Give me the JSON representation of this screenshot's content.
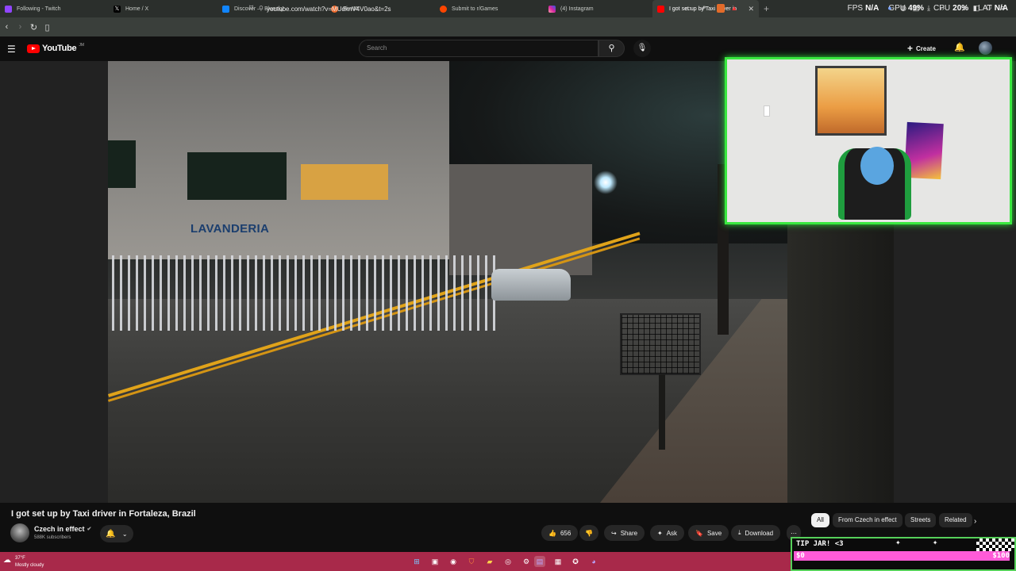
{
  "browser": {
    "tabs": [
      {
        "label": "Following - Twitch",
        "color": "#9146ff"
      },
      {
        "label": "Home / X",
        "color": "#000000"
      },
      {
        "label": "Discover — Bluesky",
        "color": "#1185fe"
      },
      {
        "label": "FiveM",
        "color": "#f06a2b"
      },
      {
        "label": "Submit to r/Games",
        "color": "#ff4500"
      },
      {
        "label": "(4) Instagram",
        "color": "#d6249f"
      },
      {
        "label": "I got set up by Taxi driver in",
        "color": "#ff0000",
        "active": true
      }
    ],
    "url": "youtube.com/watch?v=MUdknV4V0ao&t=2s"
  },
  "stats": {
    "fps_label": "FPS",
    "fps_value": "N/A",
    "gpu_label": "GPU",
    "gpu_value": "49%",
    "cpu_label": "CPU",
    "cpu_value": "20%",
    "lat_label": "LAT",
    "lat_value": "N/A"
  },
  "youtube": {
    "logo_text": "YouTube",
    "region": "JM",
    "search_placeholder": "Search",
    "create_label": "Create"
  },
  "video": {
    "sign_text": "LAVANDERIA",
    "title": "I got set up by Taxi driver in Fortaleza, Brazil",
    "channel": "Czech in effect",
    "subscribers": "588K subscribers",
    "likes": "656",
    "share_label": "Share",
    "ask_label": "Ask",
    "save_label": "Save",
    "download_label": "Download"
  },
  "chips": [
    "All",
    "From Czech in effect",
    "Streets",
    "Related"
  ],
  "taskbar": {
    "temp": "37°F",
    "condition": "Mostly cloudy"
  },
  "tipjar": {
    "label": "TIP JAR! <3",
    "amount": "$0",
    "goal": "$100",
    "progress": 0
  }
}
